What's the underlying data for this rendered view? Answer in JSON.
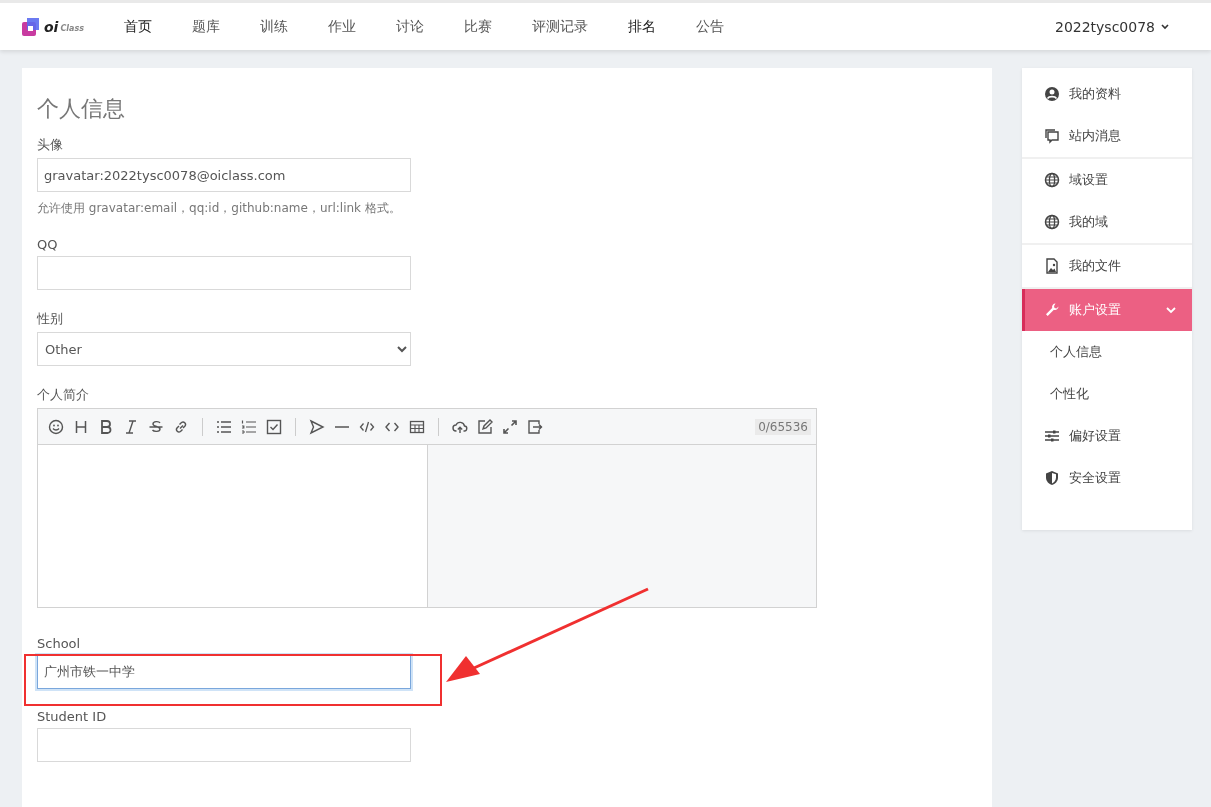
{
  "nav": {
    "logo": {
      "main": "oi",
      "sub": "Class"
    },
    "items": [
      {
        "label": "首页",
        "emphasized": true
      },
      {
        "label": "题库",
        "emphasized": false
      },
      {
        "label": "训练",
        "emphasized": false
      },
      {
        "label": "作业",
        "emphasized": false
      },
      {
        "label": "讨论",
        "emphasized": false
      },
      {
        "label": "比赛",
        "emphasized": false
      },
      {
        "label": "评测记录",
        "emphasized": false
      },
      {
        "label": "排名",
        "emphasized": true
      },
      {
        "label": "公告",
        "emphasized": false
      }
    ],
    "user": "2022tysc0078"
  },
  "form": {
    "title": "个人信息",
    "avatar": {
      "label": "头像",
      "value": "gravatar:2022tysc0078@oiclass.com",
      "help": "允许使用 gravatar:email，qq:id，github:name，url:link 格式。"
    },
    "qq": {
      "label": "QQ"
    },
    "gender": {
      "label": "性别",
      "value": "Other"
    },
    "bio": {
      "label": "个人简介",
      "counter": "0/65536"
    },
    "school": {
      "label": "School",
      "value": "广州市铁一中学",
      "focused": true
    },
    "student_id": {
      "label": "Student ID"
    }
  },
  "sidebar": {
    "groups": [
      [
        {
          "label": "我的资料",
          "selected": false
        },
        {
          "label": "站内消息",
          "selected": false
        }
      ],
      [
        {
          "label": "域设置",
          "selected": false
        },
        {
          "label": "我的域",
          "selected": false
        }
      ],
      [
        {
          "label": "我的文件",
          "selected": false
        }
      ],
      [
        {
          "label": "账户设置",
          "selected": true,
          "expanded": true,
          "children": [
            {
              "label": "个人信息"
            },
            {
              "label": "个性化"
            }
          ]
        },
        {
          "label": "偏好设置",
          "selected": false
        },
        {
          "label": "安全设置",
          "selected": false
        }
      ]
    ]
  }
}
